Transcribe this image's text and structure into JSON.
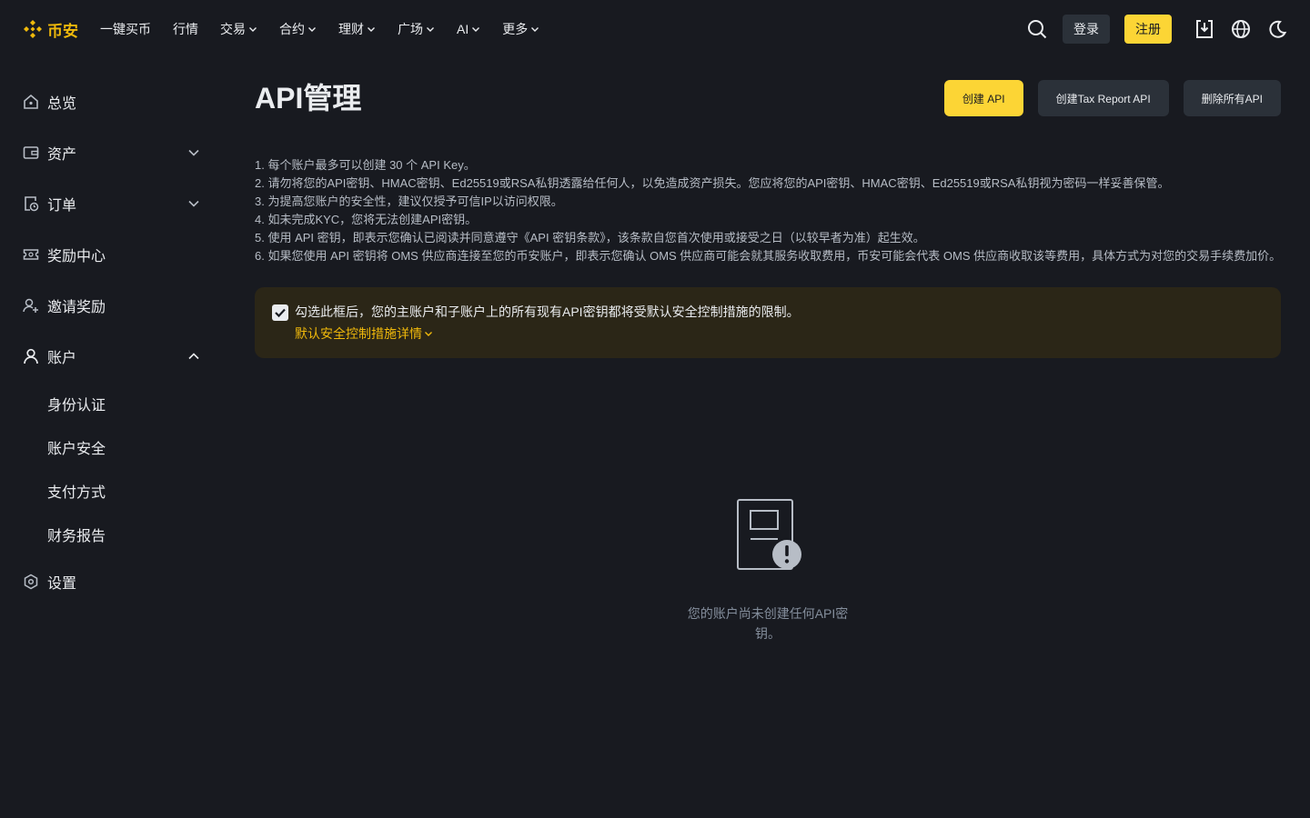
{
  "header": {
    "brand": "币安",
    "nav": [
      {
        "label": "一键买币",
        "dropdown": false
      },
      {
        "label": "行情",
        "dropdown": false
      },
      {
        "label": "交易",
        "dropdown": true
      },
      {
        "label": "合约",
        "dropdown": true
      },
      {
        "label": "理财",
        "dropdown": true
      },
      {
        "label": "广场",
        "dropdown": true
      },
      {
        "label": "AI",
        "dropdown": true
      },
      {
        "label": "更多",
        "dropdown": true
      }
    ],
    "login_label": "登录",
    "register_label": "注册"
  },
  "sidebar": {
    "items": [
      {
        "label": "总览"
      },
      {
        "label": "资产"
      },
      {
        "label": "订单"
      },
      {
        "label": "奖励中心"
      },
      {
        "label": "邀请奖励"
      },
      {
        "label": "账户"
      },
      {
        "label": "设置"
      }
    ],
    "account_sub": [
      {
        "label": "身份认证"
      },
      {
        "label": "账户安全"
      },
      {
        "label": "支付方式"
      },
      {
        "label": "财务报告"
      }
    ]
  },
  "main": {
    "title": "API管理",
    "create_api_label": "创建 API",
    "create_tax_api_label": "创建Tax Report API",
    "delete_all_label": "删除所有API",
    "notes": [
      "1. 每个账户最多可以创建 30 个 API Key。",
      "2. 请勿将您的API密钥、HMAC密钥、Ed25519或RSA私钥透露给任何人，以免造成资产损失。您应将您的API密钥、HMAC密钥、Ed25519或RSA私钥视为密码一样妥善保管。",
      "3. 为提高您账户的安全性，建议仅授予可信IP以访问权限。",
      "4. 如未完成KYC，您将无法创建API密钥。",
      "5. 使用 API 密钥，即表示您确认已阅读并同意遵守《API 密钥条款》，该条款自您首次使用或接受之日（以较早者为准）起生效。",
      "6. 如果您使用 API 密钥将 OMS 供应商连接至您的币安账户，即表示您确认 OMS 供应商可能会就其服务收取费用，币安可能会代表 OMS 供应商收取该等费用，具体方式为对您的交易手续费加价。"
    ],
    "warning_text": "勾选此框后，您的主账户和子账户上的所有现有API密钥都将受默认安全控制措施的限制。",
    "warning_link": "默认安全控制措施详情",
    "warning_checked": true,
    "empty_text": "您的账户尚未创建任何API密钥。"
  },
  "colors": {
    "background": "#181a20",
    "accent": "#fcd535",
    "brand": "#f0b90b",
    "button_secondary": "#2b3139",
    "warning_bg": "#2b2617",
    "muted_text": "#848e9c"
  }
}
